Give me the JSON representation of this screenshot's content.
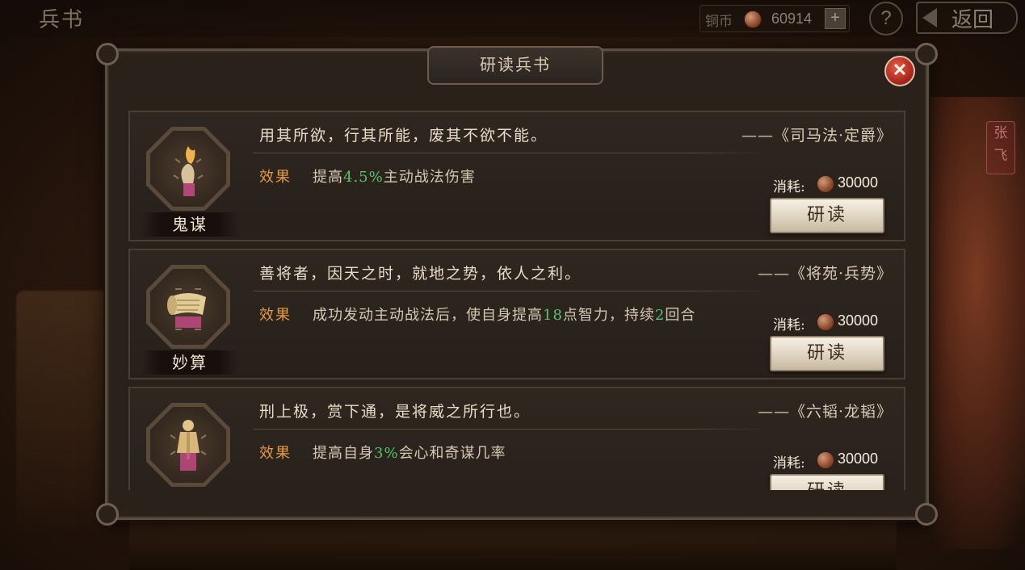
{
  "top_bar": {
    "title": "兵书",
    "currency_label": "铜币",
    "currency_amount": "60914",
    "plus_label": "+",
    "help_label": "?",
    "back_label": "返回"
  },
  "background": {
    "banner_text_1": "张",
    "banner_text_2": "飞"
  },
  "panel": {
    "title": "研读兵书",
    "close_label": "✕"
  },
  "cost_label": "消耗:",
  "effect_label": "效果",
  "button_label": "研读",
  "books": [
    {
      "name": "鬼谋",
      "icon": "flame-hand-icon",
      "quote": "用其所欲，行其所能，废其不欲不能。",
      "source": "——《司马法·定爵》",
      "effect_pre": "提高",
      "effect_hl": "4.5%",
      "effect_post": "主动战法伤害",
      "cost": "30000"
    },
    {
      "name": "妙算",
      "icon": "scroll-icon",
      "quote": "善将者，因天之时，就地之势，依人之利。",
      "source": "——《将苑·兵势》",
      "effect_pre": "成功发动主动战法后，使自身提高",
      "effect_hl": "18",
      "effect_mid": "点智力，持续",
      "effect_hl2": "2",
      "effect_post": "回合",
      "cost": "30000"
    },
    {
      "name": "",
      "icon": "warrior-statue-icon",
      "quote": "刑上极，赏下通，是将威之所行也。",
      "source": "——《六韬·龙韬》",
      "effect_pre": "提高自身",
      "effect_hl": "3%",
      "effect_post": "会心和奇谋几率",
      "cost": "30000"
    }
  ],
  "colors": {
    "effect_label": "#e49a3e",
    "highlight": "#56c46a",
    "close_button": "#a8261c"
  }
}
